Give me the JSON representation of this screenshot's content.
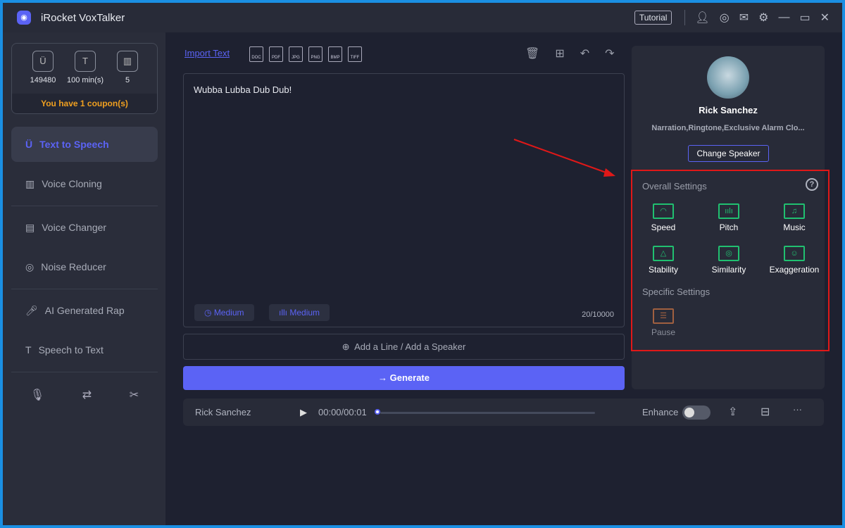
{
  "app": {
    "title": "iRocket VoxTalker",
    "tutorial": "Tutorial"
  },
  "stats": {
    "characters": "149480",
    "minutes": "100 min(s)",
    "count": "5",
    "coupon": "You have 1 coupon(s)"
  },
  "sidebar": {
    "items": [
      {
        "label": "Text to Speech",
        "active": true
      },
      {
        "label": "Voice Cloning"
      },
      {
        "label": "Voice Changer"
      },
      {
        "label": "Noise Reducer"
      },
      {
        "label": "AI Generated Rap"
      },
      {
        "label": "Speech to Text"
      }
    ]
  },
  "toolbar": {
    "import": "Import Text",
    "file_types": [
      "DOC",
      "PDF",
      "JPG",
      "PNG",
      "BMP",
      "TIFF"
    ]
  },
  "editor": {
    "text": "Wubba Lubba Dub Dub!",
    "speed_pill": "Medium",
    "pitch_pill": "Medium",
    "count": "20/10000"
  },
  "add_line": "Add a Line / Add a Speaker",
  "generate": "Generate",
  "player": {
    "speaker": "Rick Sanchez",
    "time": "00:00/00:01",
    "progress": 0,
    "enhance": "Enhance",
    "enhance_on": false
  },
  "speaker": {
    "name": "Rick Sanchez",
    "tags": "Narration,Ringtone,Exclusive Alarm Clo...",
    "change": "Change Speaker"
  },
  "settings": {
    "overall": "Overall Settings",
    "options": [
      "Speed",
      "Pitch",
      "Music",
      "Stability",
      "Similarity",
      "Exaggeration"
    ],
    "specific": "Specific Settings",
    "pause": "Pause"
  },
  "colors": {
    "accent": "#5b63f5",
    "settings_icon": "#20c070",
    "highlight_box": "#e01818",
    "coupon": "#f0a020"
  }
}
